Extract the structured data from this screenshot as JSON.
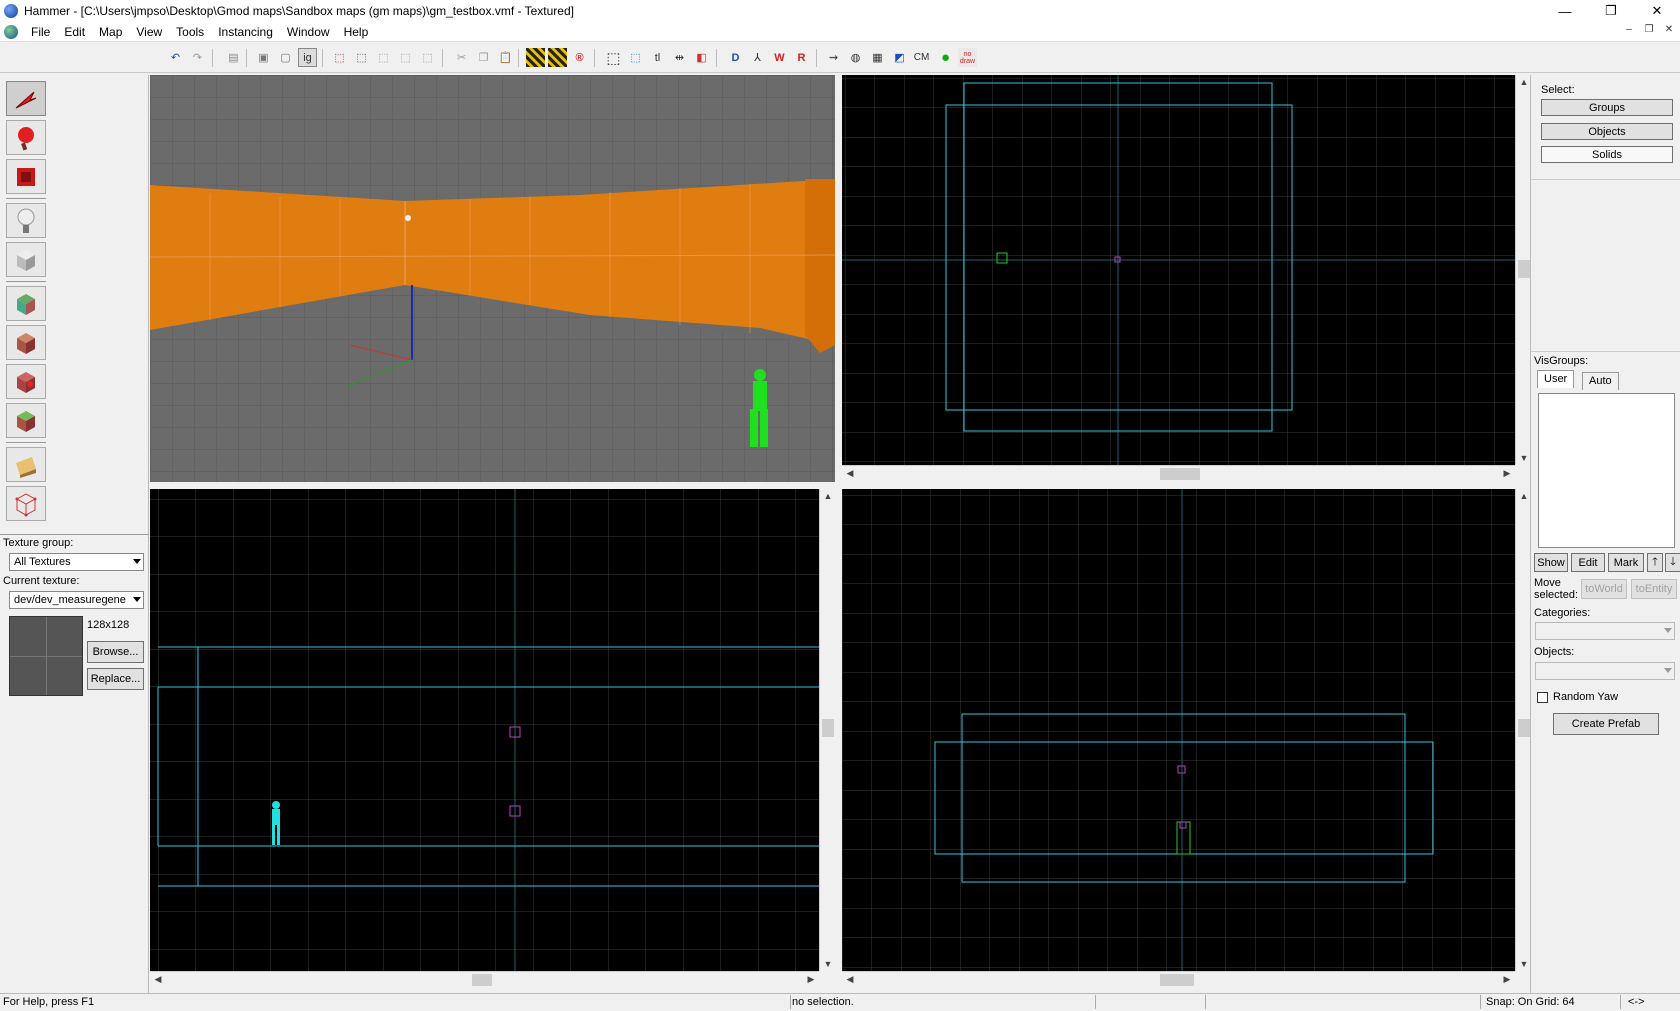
{
  "window": {
    "title": "Hammer - [C:\\Users\\jmpso\\Desktop\\Gmod maps\\Sandbox maps (gm maps)\\gm_testbox.vmf - Textured]",
    "minimize": "—",
    "restore": "❐",
    "close": "✕"
  },
  "menu": [
    "File",
    "Edit",
    "Map",
    "View",
    "Tools",
    "Instancing",
    "Window",
    "Help"
  ],
  "toolbar": {
    "icons": [
      "undo-icon",
      "redo-icon",
      "save-icon",
      "group-icon",
      "ungroup-icon",
      "ignore-groups-icon",
      "hide-selected-icon",
      "hide-unselected-icon",
      "show-all-icon",
      "carve-icon",
      "cut-icon",
      "copy-icon",
      "paste-icon",
      "hazard-icon",
      "toggle-texlock-icon",
      "toggle-scale-lock-icon",
      "box-select-icon",
      "selection-mode-icon",
      "toggle-texture-icon",
      "transform-icon",
      "flip-icon",
      "toggle-helpers-icon",
      "toggle-models-icon",
      "smooth-icon",
      "decals-icon",
      "nodraw-icon",
      "vertex-icon",
      "wireframe-icon",
      "grid-icon",
      "lighting-icon",
      "cordon-icon",
      "compile-icon",
      "nodraw-toggle-icon"
    ],
    "ig_label": "ig",
    "tl_label": "tl",
    "cm_label": "CM",
    "nodraw_label": "no draw"
  },
  "tools": [
    "selection-tool",
    "magnify-tool",
    "camera-tool",
    "entity-tool",
    "block-tool",
    "texture-application-tool",
    "apply-current-texture-tool",
    "decal-tool",
    "overlay-tool",
    "clipping-tool",
    "vertex-tool"
  ],
  "texture_panel": {
    "group_label": "Texture group:",
    "group_value": "All Textures",
    "current_label": "Current texture:",
    "current_value": "dev/dev_measuregene",
    "size": "128x128",
    "browse": "Browse...",
    "replace": "Replace..."
  },
  "right_panel": {
    "select_label": "Select:",
    "groups": "Groups",
    "objects": "Objects",
    "solids": "Solids",
    "visgroups_label": "VisGroups:",
    "tab_user": "User",
    "tab_auto": "Auto",
    "show": "Show",
    "edit": "Edit",
    "mark": "Mark",
    "up": "🡑",
    "down": "🡓",
    "move_selected": "Move selected:",
    "to_world": "toWorld",
    "to_entity": "toEntity",
    "categories_label": "Categories:",
    "objects_label": "Objects:",
    "random_yaw": "Random Yaw",
    "create_prefab": "Create Prefab"
  },
  "status": {
    "help": "For Help, press F1",
    "selection": "no selection.",
    "snap": "Snap: On Grid: 64",
    "arrows": "<->"
  },
  "colors": {
    "wall": "#e07d10",
    "grid": "#3a3a3a",
    "brush_outline": "#33c4e0",
    "entity": "#c040c0",
    "player": "#22cc22"
  }
}
